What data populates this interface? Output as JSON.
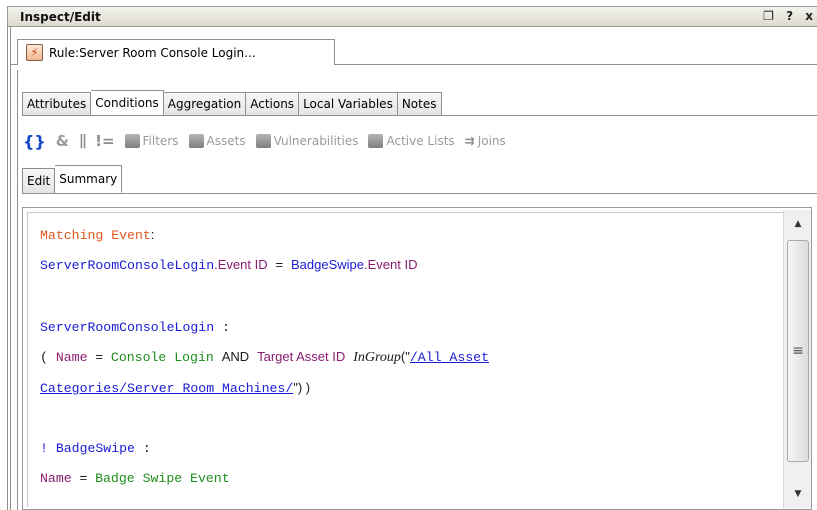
{
  "window": {
    "title": "Inspect/Edit",
    "controls": "❐ ? x"
  },
  "rule_tab": {
    "label": "Rule:Server Room Console Login..."
  },
  "tabs": [
    "Attributes",
    "Conditions",
    "Aggregation",
    "Actions",
    "Local Variables",
    "Notes"
  ],
  "active_tab": "Conditions",
  "toolbar": {
    "braces": "{}",
    "and": "&",
    "or": "||",
    "not": "!=",
    "filters": "Filters",
    "assets": "Assets",
    "vulnerabilities": "Vulnerabilities",
    "active_lists": "Active Lists",
    "joins": "Joins"
  },
  "subtabs": [
    "Edit",
    "Summary"
  ],
  "active_subtab": "Summary",
  "summary": {
    "l1": "Matching Event",
    "l1_colon": ":",
    "l2_a": "ServerRoomConsoleLogin",
    "l2_b": ".Event ID",
    "l2_eq": "=",
    "l2_c": "BadgeSwipe",
    "l2_d": ".Event ID",
    "l3_a": "ServerRoomConsoleLogin",
    "l3_colon": ":",
    "l4_open": "( ",
    "l4_name": "Name",
    "l4_eq": "=",
    "l4_val": "Console Login",
    "l4_and": "AND",
    "l4_field": "Target Asset ID",
    "l4_op": "InGroup",
    "l4_paren": "(\"",
    "l4_link": "/All Asset",
    "l5_link": "Categories/Server Room Machines/",
    "l5_close": "\") )",
    "l6_not": "! ",
    "l6_a": "BadgeSwipe",
    "l6_colon": ":",
    "l7_name": "Name",
    "l7_eq": "=",
    "l7_val": "Badge Swipe Event"
  },
  "scrollbar": {
    "up": "▲",
    "down": "▼",
    "grip": "≡"
  }
}
